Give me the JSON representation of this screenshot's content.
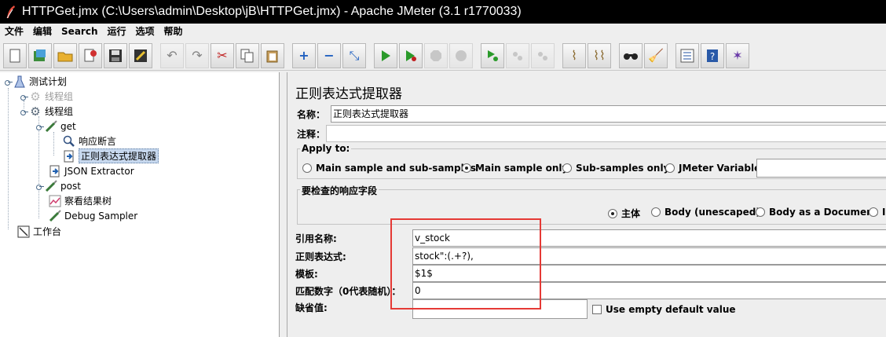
{
  "window": {
    "title": "HTTPGet.jmx (C:\\Users\\admin\\Desktop\\jB\\HTTPGet.jmx) - Apache JMeter (3.1 r1770033)"
  },
  "menu": [
    "文件",
    "编辑",
    "Search",
    "运行",
    "选项",
    "帮助"
  ],
  "toolbar": {
    "buttons": [
      "new",
      "templates",
      "open",
      "close",
      "save",
      "save-as",
      "undo",
      "redo",
      "cut",
      "copy",
      "paste",
      "expand",
      "collapse",
      "toggle",
      "start",
      "start-no-pause",
      "stop",
      "shutdown",
      "remote-start",
      "remote-stop",
      "remote-shutdown",
      "clear",
      "clear-all",
      "search",
      "reset-search",
      "function-helper",
      "help",
      "logo"
    ]
  },
  "tree": {
    "items": [
      {
        "label": "测试计划",
        "icon": "test-plan-icon"
      },
      {
        "label": "线程组",
        "icon": "gear-icon",
        "disabled": true
      },
      {
        "label": "线程组",
        "icon": "gear-icon"
      },
      {
        "label": "get",
        "icon": "sampler-icon"
      },
      {
        "label": "响应断言",
        "icon": "magnifier-icon"
      },
      {
        "label": "正则表达式提取器",
        "icon": "extractor-icon",
        "selected": true
      },
      {
        "label": "JSON Extractor",
        "icon": "extractor-icon"
      },
      {
        "label": "post",
        "icon": "sampler-icon"
      },
      {
        "label": "察看结果树",
        "icon": "chart-icon"
      },
      {
        "label": "Debug Sampler",
        "icon": "sampler-icon"
      },
      {
        "label": "工作台",
        "icon": "workbench-icon"
      }
    ]
  },
  "editor": {
    "title": "正则表达式提取器",
    "name_label": "名称：",
    "name_value": "正则表达式提取器",
    "comment_label": "注释：",
    "apply_to": {
      "legend": "Apply to:",
      "options": [
        "Main sample and sub-samples",
        "Main sample only",
        "Sub-samples only",
        "JMeter Variable"
      ],
      "selected": "Main sample only"
    },
    "field_check": {
      "legend": "要检查的响应字段",
      "options": [
        "主体",
        "Body (unescaped)",
        "Body as a Document",
        "I"
      ],
      "selected": "主体"
    },
    "ref_name_label": "引用名称:",
    "ref_name_value": "v_stock",
    "regex_label": "正则表达式:",
    "regex_value": "stock\":(.+?),",
    "template_label": "模板:",
    "template_value": "$1$",
    "match_no_label": "匹配数字（0代表随机）：",
    "match_no_value": "0",
    "default_label": "缺省值:",
    "default_value": "",
    "use_empty_label": "Use empty default value"
  },
  "colors": {
    "highlight_box": "#e53935",
    "selection": "#c7d8ee"
  }
}
